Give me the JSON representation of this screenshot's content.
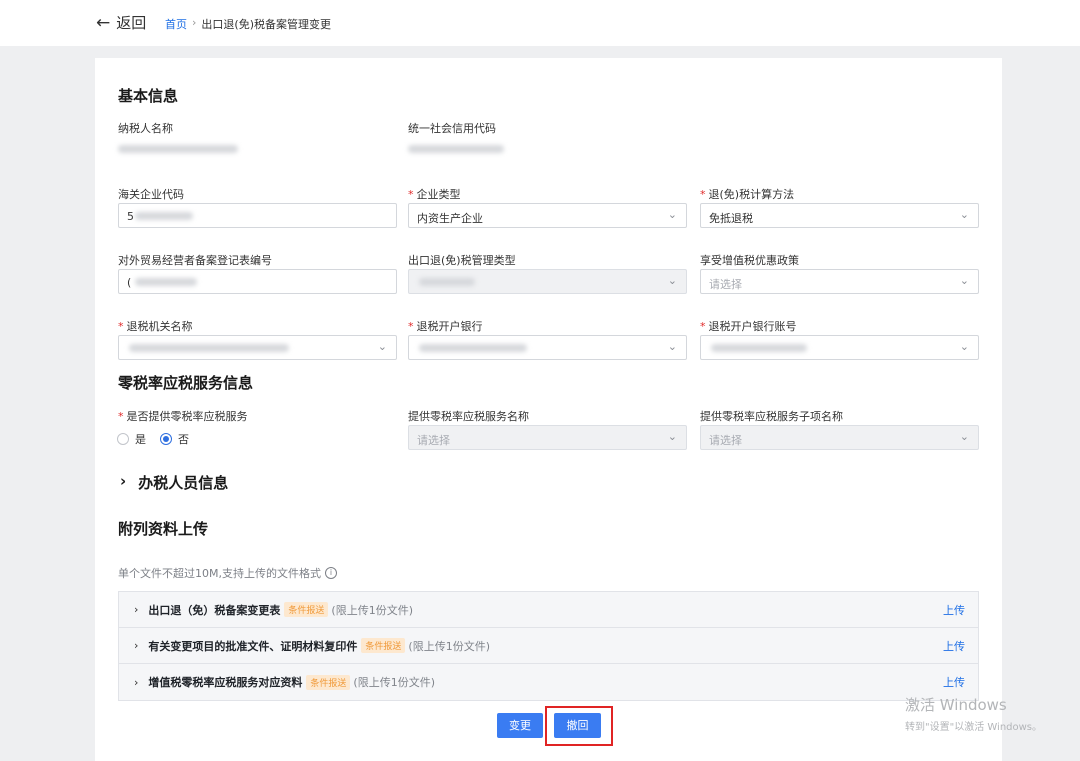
{
  "header": {
    "back_label": "返回",
    "breadcrumb": {
      "home": "首页",
      "separator": "›",
      "current": "出口退(免)税备案管理变更"
    }
  },
  "basic_info": {
    "title": "基本信息",
    "taxpayer_name_label": "纳税人名称",
    "credit_code_label": "统一社会信用代码",
    "customs_code_label": "海关企业代码",
    "customs_code_prefix": "5",
    "enterprise_type_label": "企业类型",
    "enterprise_type_value": "内资生产企业",
    "calc_method_label": "退(免)税计算方法",
    "calc_method_value": "免抵退税",
    "foreign_trade_label": "对外贸易经营者备案登记表编号",
    "foreign_trade_prefix": "(",
    "mgmt_type_label": "出口退(免)税管理类型",
    "vat_policy_label": "享受增值税优惠政策",
    "vat_policy_placeholder": "请选择",
    "tax_office_label": "退税机关名称",
    "bank_label": "退税开户银行",
    "bank_account_label": "退税开户银行账号"
  },
  "zero_rate": {
    "title": "零税率应税服务信息",
    "provide_label": "是否提供零税率应税服务",
    "option_yes": "是",
    "option_no": "否",
    "selected": "否",
    "service_name_label": "提供零税率应税服务名称",
    "service_name_placeholder": "请选择",
    "sub_item_label": "提供零税率应税服务子项名称",
    "sub_item_placeholder": "请选择"
  },
  "staff_section": {
    "title": "办税人员信息"
  },
  "attachments": {
    "title": "附列资料上传",
    "hint": "单个文件不超过10M,支持上传的文件格式",
    "info_glyph": "i",
    "upload_label": "上传",
    "items": [
      {
        "name": "出口退（免）税备案变更表",
        "tag": "条件报送",
        "limit": "(限上传1份文件)"
      },
      {
        "name": "有关变更项目的批准文件、证明材料复印件",
        "tag": "条件报送",
        "limit": "(限上传1份文件)"
      },
      {
        "name": "增值税零税率应税服务对应资料",
        "tag": "条件报送",
        "limit": "(限上传1份文件)"
      }
    ]
  },
  "actions": {
    "change": "变更",
    "withdraw": "撤回"
  },
  "watermark": {
    "line1": "激活 Windows",
    "line2": "转到\"设置\"以激活 Windows。"
  },
  "icons": {
    "back": "arrow-left-icon",
    "dropdown": "chevron-down-icon",
    "expand": "chevron-right-icon",
    "info": "info-circle-icon"
  },
  "colors": {
    "accent": "#3a7cf2",
    "link": "#1f6fe5",
    "required": "#e02a2a",
    "tag_bg": "#fde8cf",
    "tag_fg": "#f09a3a",
    "highlight": "#e02424"
  }
}
